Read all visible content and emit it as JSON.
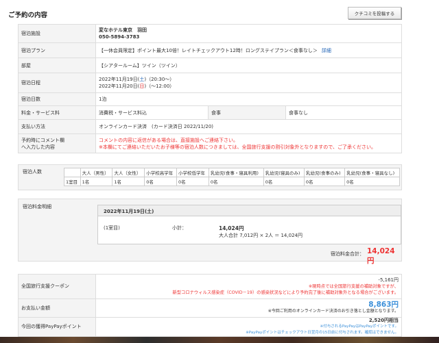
{
  "header": {
    "title": "ご予約の内容",
    "review_button": "クチコミを投稿する"
  },
  "details": {
    "hotel_label": "宿泊施設",
    "hotel_name": "変なホテル東京　羽田",
    "hotel_tel": "050-5894-3783",
    "plan_label": "宿泊プラン",
    "plan_value": "【一休会員限定】ポイント最大10倍！レイトチェックアウト12時！ロングステイプラン＜食事なし＞",
    "plan_link": "詳細",
    "room_label": "部屋",
    "room_value": "【シアタールーム】ツイン（ツイン）",
    "date_label": "宿泊日程",
    "checkin_prefix": "2022年11月19日(",
    "checkin_day": "土",
    "checkin_suffix": ")（20:30〜）",
    "checkout_prefix": "2022年11月20日(",
    "checkout_day": "日",
    "checkout_suffix": ")（〜12:00）",
    "nights_label": "宿泊日数",
    "nights_value": "1泊",
    "fee_label": "料金・サービス料",
    "fee_value": "消費税・サービス料込",
    "meal_label": "食事",
    "meal_value": "食事なし",
    "payment_label": "支払い方法",
    "payment_value": "オンラインカード決済　(カード決済日 2022/11/20)",
    "comment_label_1": "予約時にコメント欄",
    "comment_label_2": "へ入力した内容",
    "comment_note_1": "コメントの内容に返信がある場合は、直接施設へご連絡下さい。",
    "comment_note_2": "※本欄にてご連絡いただいたお子様等の宿泊人数につきましては、全国旅行支援の割引対象外となりますので、ご了承ください。"
  },
  "guests": {
    "label": "宿泊人数",
    "headers": [
      "大人（男性）",
      "大人（女性）",
      "小学校高学年",
      "小学校低学年",
      "乳幼児(食事・寝具利用)",
      "乳幼児(寝具のみ)",
      "乳幼児(食事のみ)",
      "乳幼児(食事・寝具なし)"
    ],
    "row_label": "1室目",
    "values": [
      "1名",
      "1名",
      "0名",
      "0名",
      "0名",
      "0名",
      "0名",
      "0名"
    ]
  },
  "fee_breakdown": {
    "label": "宿泊料金明細",
    "date": "2022年11月19日(土)",
    "room": "(1室目)",
    "subtotal_label": "小計：",
    "subtotal": "14,024円",
    "detail": "大人合計 7,012円 × 2人 ＝ 14,024円",
    "total_label": "宿泊料金合計：",
    "total": "14,024円"
  },
  "payment": {
    "coupon_label": "全国旅行支援クーポン",
    "coupon_amount": "-5,161円",
    "coupon_note_1": "※現時点では全国旅行支援の補助対象ですが、",
    "coupon_note_2": "新型コロナウィルス感染症（COVID－19）の感染状況などにより予約完了後に補助対象外となる場合がございます。",
    "pay_label": "お支払い金額",
    "pay_amount": "8,863円",
    "pay_note": "※今回ご利用のオンラインカード決済のお引き落とし金額となります。",
    "points_label": "今回の獲得PayPayポイント",
    "points_amount": "2,520円相当",
    "points_note_1": "※付与されるPayPayはPayPayポイントです。",
    "points_note_2": "※PayPayポイントはチェックアウト日翌月の15日前に付与されます。確認はできません。"
  },
  "colors": {
    "accent_red": "#e33333",
    "accent_blue": "#3b8fd9",
    "label_bg": "#f4f4f4"
  }
}
